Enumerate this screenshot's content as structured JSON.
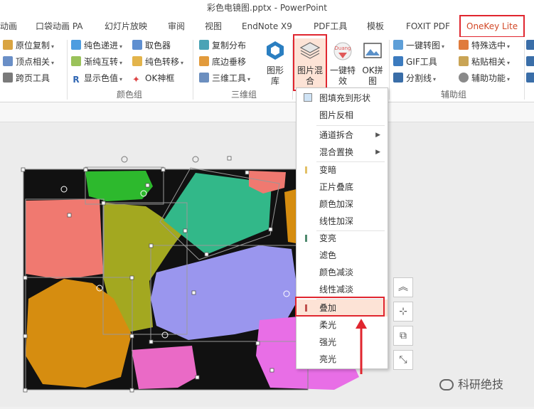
{
  "window": {
    "title": "彩色电镜图.pptx - PowerPoint"
  },
  "tabs": [
    "动画",
    "口袋动画 PA",
    "幻灯片放映",
    "审阅",
    "视图",
    "EndNote X9",
    "PDF工具",
    "模板",
    "FOXIT PDF",
    "OneKey Lite"
  ],
  "ribbon": {
    "col1": [
      "原位复制",
      "顶点相关",
      "跨页工具"
    ],
    "col2": [
      "纯色递进",
      "渐纯互转",
      "显示色值"
    ],
    "col3": [
      "取色器",
      "纯色转移",
      "OK神框"
    ],
    "col4": [
      "复制分布",
      "底边垂移",
      "三维工具"
    ],
    "big": {
      "shape_lib": "图形\n库",
      "pic_blend": "图片混\n合",
      "one_key": "一键特\n效",
      "ok_puzzle": "OK拼\n图"
    },
    "col5": [
      "一键转图",
      "GIF工具",
      "分割线"
    ],
    "col6": [
      "特殊选中",
      "粘贴相关",
      "辅助功能"
    ],
    "groups": {
      "color": "颜色组",
      "three_d": "三维组",
      "aux": "辅助组"
    }
  },
  "menu": {
    "items": [
      "图填充到形状",
      "图片反相",
      "通道拆合",
      "混合置换",
      "变暗",
      "正片叠底",
      "颜色加深",
      "线性加深",
      "变亮",
      "滤色",
      "颜色减淡",
      "线性减淡",
      "叠加",
      "柔光",
      "强光",
      "亮光"
    ],
    "highlighted": "叠加"
  },
  "watermark": "科研绝技",
  "colors": {
    "accent_red": "#e0262f",
    "highlight": "#fde3d6"
  }
}
